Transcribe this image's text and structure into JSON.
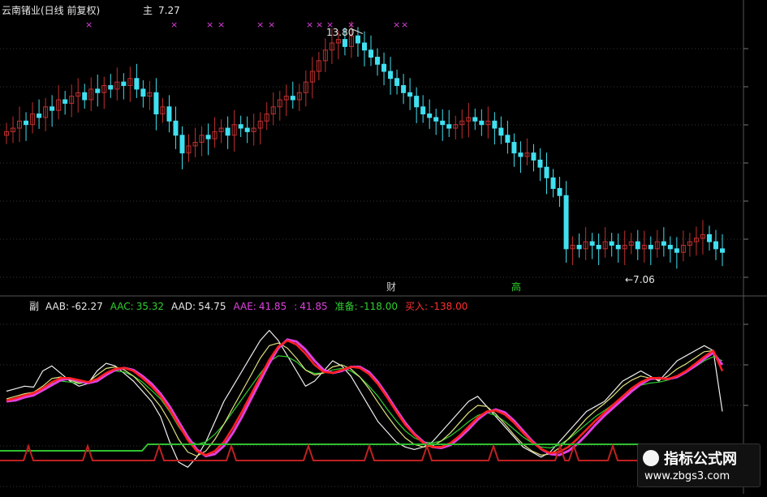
{
  "header": {
    "title": "云南锗业(日线 前复权)",
    "price_label": "主",
    "price_value": "7.27"
  },
  "annotations": {
    "high": "13.80",
    "low": "←7.06",
    "marker_left": "财",
    "marker_right": "高"
  },
  "indicator_header": {
    "prefix": "副",
    "items": [
      {
        "label": "AAB:",
        "value": "-62.27",
        "color": "#e8e8e8"
      },
      {
        "label": "AAC:",
        "value": "35.32",
        "color": "#30d030"
      },
      {
        "label": "AAD:",
        "value": "54.75",
        "color": "#e8e8e8"
      },
      {
        "label": "AAE:",
        "value": "41.85",
        "color": "#e040e0"
      },
      {
        "label": ":",
        "value": "41.85",
        "color": "#e040e0"
      },
      {
        "label": "准备:",
        "value": "-118.00",
        "color": "#30d030"
      },
      {
        "label": "买入:",
        "value": "-138.00",
        "color": "#ff3030"
      }
    ]
  },
  "watermark": {
    "name": "指标公式网",
    "url": "www.zbgs3.com"
  },
  "colors": {
    "up": "#c03030",
    "down": "#40e0f0",
    "grid": "#444",
    "magenta": "#e040e0",
    "red": "#ff2020",
    "green": "#30d030",
    "yellow": "#e0e080",
    "white": "#f0f0f0",
    "signal_green": "#30c030",
    "signal_red": "#c02020"
  },
  "chart_data": [
    {
      "type": "candlestick",
      "title": "云南锗业(日线 前复权)",
      "y_axis": {
        "min": 6.5,
        "max": 14.2
      },
      "high_marker": 13.8,
      "low_marker": 7.06,
      "closes": [
        10.9,
        11.0,
        11.2,
        11.1,
        11.4,
        11.3,
        11.6,
        11.5,
        11.8,
        11.7,
        11.9,
        12.0,
        11.8,
        12.1,
        12.0,
        12.2,
        12.1,
        12.3,
        12.2,
        12.4,
        12.1,
        11.9,
        12.0,
        11.4,
        11.6,
        11.2,
        10.8,
        10.3,
        10.5,
        10.6,
        10.8,
        10.7,
        10.9,
        11.0,
        10.8,
        11.1,
        11.0,
        10.9,
        11.0,
        11.2,
        11.4,
        11.6,
        11.8,
        11.9,
        11.8,
        12.0,
        12.3,
        12.6,
        12.9,
        13.2,
        13.4,
        13.5,
        13.3,
        13.6,
        13.4,
        13.2,
        13.0,
        12.8,
        12.6,
        12.4,
        12.2,
        12.0,
        11.9,
        11.6,
        11.4,
        11.3,
        11.2,
        11.1,
        11.0,
        11.1,
        11.2,
        11.3,
        11.2,
        11.1,
        11.2,
        11.0,
        10.8,
        10.6,
        10.3,
        10.2,
        10.3,
        10.1,
        9.9,
        9.6,
        9.3,
        9.1,
        7.6,
        7.7,
        7.6,
        7.8,
        7.7,
        7.6,
        7.8,
        7.7,
        7.6,
        7.7,
        7.8,
        7.6,
        7.7,
        7.6,
        7.8,
        7.7,
        7.6,
        7.5,
        7.7,
        7.8,
        7.9,
        8.0,
        7.8,
        7.6,
        7.5
      ]
    },
    {
      "type": "line",
      "title": "",
      "y_axis": {
        "min": -160,
        "max": 160
      },
      "series": [
        {
          "name": "AAB",
          "color": "#f0f0f0",
          "values": [
            20,
            25,
            30,
            28,
            60,
            70,
            55,
            40,
            30,
            35,
            60,
            75,
            70,
            55,
            40,
            20,
            0,
            -30,
            -80,
            -120,
            -130,
            -110,
            -80,
            -40,
            0,
            30,
            60,
            90,
            120,
            140,
            120,
            90,
            60,
            30,
            40,
            60,
            80,
            70,
            50,
            20,
            -10,
            -40,
            -60,
            -80,
            -90,
            -95,
            -90,
            -80,
            -60,
            -40,
            -20,
            0,
            10,
            -10,
            -30,
            -50,
            -70,
            -90,
            -100,
            -110,
            -100,
            -80,
            -60,
            -40,
            -20,
            -10,
            0,
            20,
            40,
            50,
            60,
            50,
            40,
            60,
            80,
            90,
            100,
            110,
            100,
            -20
          ]
        },
        {
          "name": "AAC",
          "color": "#30d030",
          "values": [
            0,
            5,
            10,
            15,
            25,
            35,
            40,
            38,
            35,
            38,
            45,
            55,
            60,
            58,
            50,
            38,
            22,
            5,
            -20,
            -50,
            -75,
            -85,
            -80,
            -65,
            -45,
            -20,
            5,
            30,
            55,
            78,
            90,
            88,
            78,
            62,
            55,
            56,
            62,
            65,
            60,
            48,
            30,
            10,
            -15,
            -38,
            -58,
            -72,
            -80,
            -82,
            -78,
            -68,
            -55,
            -40,
            -28,
            -22,
            -28,
            -40,
            -55,
            -70,
            -82,
            -90,
            -92,
            -86,
            -75,
            -60,
            -45,
            -30,
            -18,
            -5,
            10,
            22,
            32,
            36,
            38,
            42,
            50,
            58,
            68,
            80,
            88,
            80
          ]
        },
        {
          "name": "AAD",
          "color": "#e0e080",
          "values": [
            5,
            10,
            15,
            18,
            30,
            45,
            48,
            42,
            36,
            38,
            52,
            65,
            68,
            62,
            50,
            32,
            12,
            -10,
            -40,
            -75,
            -100,
            -108,
            -98,
            -75,
            -45,
            -12,
            20,
            52,
            85,
            110,
            115,
            105,
            85,
            62,
            52,
            56,
            68,
            72,
            64,
            48,
            25,
            -2,
            -28,
            -52,
            -72,
            -85,
            -90,
            -88,
            -78,
            -62,
            -42,
            -22,
            -8,
            -10,
            -25,
            -45,
            -66,
            -85,
            -98,
            -106,
            -104,
            -92,
            -74,
            -54,
            -34,
            -18,
            -4,
            12,
            30,
            42,
            50,
            46,
            42,
            50,
            64,
            74,
            86,
            98,
            100,
            60
          ]
        },
        {
          "name": "AAE",
          "color": "#e040e0",
          "values": [
            0,
            2,
            8,
            12,
            22,
            32,
            42,
            45,
            40,
            36,
            40,
            52,
            62,
            66,
            62,
            50,
            35,
            15,
            -10,
            -40,
            -70,
            -95,
            -108,
            -104,
            -88,
            -62,
            -30,
            5,
            40,
            75,
            105,
            122,
            118,
            102,
            80,
            62,
            56,
            60,
            68,
            68,
            58,
            38,
            12,
            -16,
            -42,
            -64,
            -80,
            -90,
            -92,
            -86,
            -72,
            -55,
            -36,
            -22,
            -16,
            -22,
            -38,
            -58,
            -78,
            -94,
            -104,
            -106,
            -98,
            -84,
            -66,
            -46,
            -28,
            -12,
            4,
            20,
            34,
            44,
            46,
            44,
            48,
            58,
            70,
            84,
            96,
            72
          ]
        },
        {
          "name": "",
          "color": "#ff2020",
          "values": [
            2,
            6,
            12,
            16,
            26,
            38,
            46,
            46,
            42,
            38,
            44,
            56,
            64,
            66,
            60,
            46,
            30,
            10,
            -16,
            -46,
            -76,
            -98,
            -106,
            -98,
            -80,
            -52,
            -20,
            14,
            48,
            82,
            108,
            120,
            112,
            94,
            72,
            58,
            56,
            62,
            68,
            66,
            54,
            34,
            8,
            -20,
            -46,
            -66,
            -82,
            -90,
            -90,
            -82,
            -68,
            -50,
            -32,
            -20,
            -18,
            -26,
            -42,
            -62,
            -80,
            -94,
            -102,
            -100,
            -90,
            -74,
            -56,
            -38,
            -22,
            -6,
            10,
            26,
            38,
            46,
            46,
            44,
            50,
            60,
            74,
            88,
            100,
            60
          ]
        }
      ],
      "signal_levels": {
        "准备": -118.0,
        "买入": -138.0
      }
    }
  ]
}
